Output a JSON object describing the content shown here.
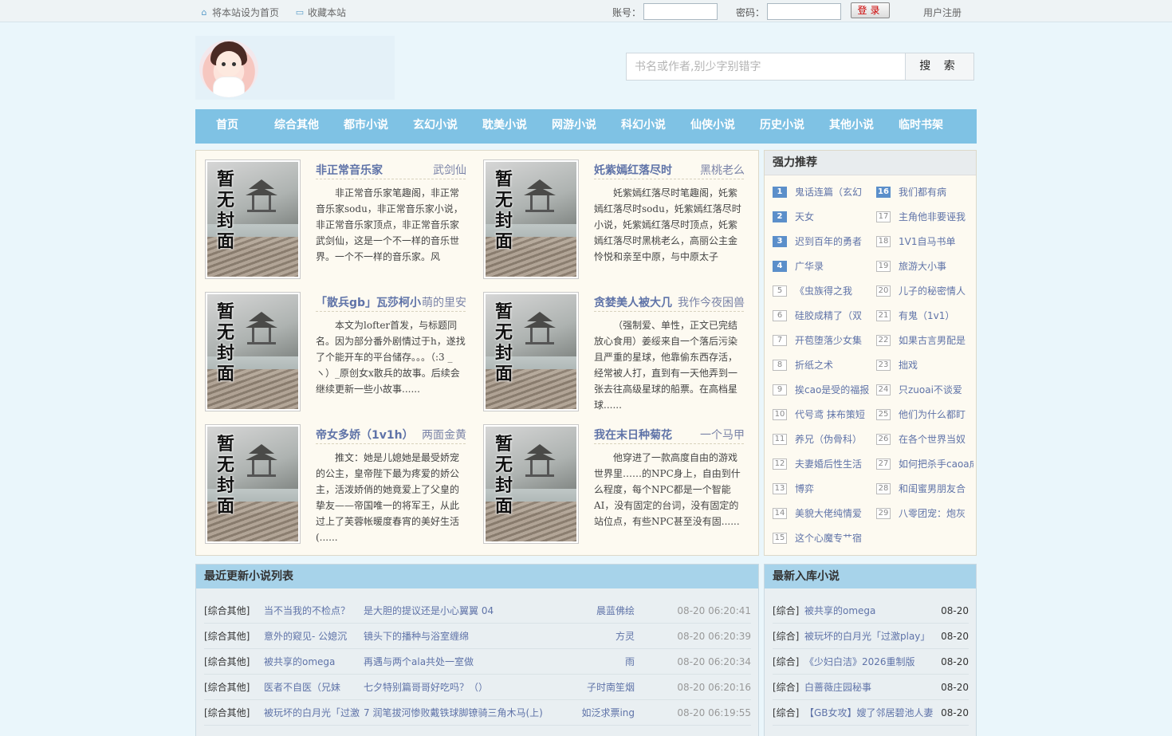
{
  "topbar": {
    "set_home": "将本站设为首页",
    "bookmark": "收藏本站",
    "account_label": "账号：",
    "password_label": "密码：",
    "account_value": "",
    "password_value": "",
    "login_button": "登录",
    "register": "用户注册"
  },
  "search": {
    "placeholder": "书名或作者,别少字别错字",
    "button": "搜 索"
  },
  "nav": [
    "首页",
    "综合其他",
    "都市小说",
    "玄幻小说",
    "耽美小说",
    "网游小说",
    "科幻小说",
    "仙侠小说",
    "历史小说",
    "其他小说",
    "临时书架"
  ],
  "cover_text": [
    "暂",
    "无",
    "封",
    "面"
  ],
  "featured": [
    {
      "title": "非正常音乐家",
      "author": "武剑仙",
      "desc": "非正常音乐家笔趣阁，非正常音乐家sodu，非正常音乐家小说，非正常音乐家顶点，非正常音乐家武剑仙，这是一个不一样的音乐世界。一个不一样的音乐家。风平......"
    },
    {
      "title": "奼紫嫣红落尽时",
      "author": "黑桃老么",
      "desc": "奼紫嫣红落尽时笔趣阁，奼紫嫣红落尽时sodu，奼紫嫣红落尽时小说，奼紫嫣红落尽时顶点，奼紫嫣红落尽时黑桃老么，高丽公主金怜悦和亲至中原，与中原太子李......"
    },
    {
      "title": "「散兵gb」瓦莎柯小",
      "author": "萌的里安",
      "desc": "本文为lofter首发，与标题同名。因为部分番外剧情过于h，遂找了个能开车的平台储存。。。（:3 _ ヽ）_原创女x散兵的故事。后续会继续更新一些小故事......"
    },
    {
      "title": "贪婪美人被大几",
      "author": "我作今夜困兽",
      "desc": "（强制爱、单性，正文已完结放心食用）姜绥来自一个落后污染且严重的星球，他靠偷东西存活，经常被人打，直到有一天他弄到一张去往高级星球的船票。在高档星球......"
    },
    {
      "title": "帝女多娇（1v1h）",
      "author": "两面金黄",
      "desc": "推文：她是儿媳她是最受娇宠的公主，皇帝陛下最为疼爱的娇公主，活泼娇俏的她竟爱上了父皇的挚友——帝国唯一的将军王，从此过上了芙蓉帐暖度春宵的美好生活(......"
    },
    {
      "title": "我在末日种菊花",
      "author": "一个马甲",
      "desc": "他穿进了一款高度自由的游戏世界里……的NPC身上，自由到什么程度，每个NPC都是一个智能AI，没有固定的台词，没有固定的站位点，有些NPC甚至没有固......"
    }
  ],
  "recommend": {
    "heading": "强力推荐",
    "items": [
      {
        "num": "1",
        "title": "鬼话连篇（玄幻"
      },
      {
        "num": "2",
        "title": "天女"
      },
      {
        "num": "3",
        "title": "迟到百年的勇者"
      },
      {
        "num": "4",
        "title": "广华录"
      },
      {
        "num": "5",
        "title": "《虫族得之我"
      },
      {
        "num": "6",
        "title": "硅胶成精了（双"
      },
      {
        "num": "7",
        "title": "开苞堕落少女集"
      },
      {
        "num": "8",
        "title": "折纸之术"
      },
      {
        "num": "9",
        "title": "挨cao是受的福报"
      },
      {
        "num": "10",
        "title": "代号鸢 抹布策短"
      },
      {
        "num": "11",
        "title": "养兄（伪骨科）"
      },
      {
        "num": "12",
        "title": "夫妻婚后性生活"
      },
      {
        "num": "13",
        "title": "博弈"
      },
      {
        "num": "14",
        "title": "美貌大佬纯情爱"
      },
      {
        "num": "15",
        "title": "这个心魔专艹宿"
      },
      {
        "num": "16",
        "title": "我们都有病"
      },
      {
        "num": "17",
        "title": "主角他非要诬我"
      },
      {
        "num": "18",
        "title": "1V1自马书单"
      },
      {
        "num": "19",
        "title": "旅游大小事"
      },
      {
        "num": "20",
        "title": "儿子的秘密情人"
      },
      {
        "num": "21",
        "title": "有鬼（1v1）"
      },
      {
        "num": "22",
        "title": "如果古言男配是"
      },
      {
        "num": "23",
        "title": "拙戏"
      },
      {
        "num": "24",
        "title": "只zuoai不谈爱"
      },
      {
        "num": "25",
        "title": "他们为什么都盯"
      },
      {
        "num": "26",
        "title": "在各个世界当奴"
      },
      {
        "num": "27",
        "title": "如何把杀手caoa成"
      },
      {
        "num": "28",
        "title": "和闺蜜男朋友合"
      },
      {
        "num": "29",
        "title": "八零团宠：炮灰"
      }
    ]
  },
  "recent": {
    "heading": "最近更新小说列表",
    "rows": [
      {
        "cat": "[综合其他]",
        "title": "当不当我的不检点？",
        "chapter": "是大胆的提议还是小心翼翼 04",
        "author": "晨蓝佛绘",
        "time": "08-20 06:20:41"
      },
      {
        "cat": "[综合其他]",
        "title": "意外的窥见- 公媳沉",
        "chapter": "镜头下的播种与浴室缠绵",
        "author": "方灵",
        "time": "08-20 06:20:39"
      },
      {
        "cat": "[综合其他]",
        "title": "被共享的omega",
        "chapter": "再遇与两个ala共处一室做",
        "author": "雨",
        "time": "08-20 06:20:34"
      },
      {
        "cat": "[综合其他]",
        "title": "医者不自医（兄妹",
        "chapter": "七夕特别篇哥哥好吃吗？（）",
        "author": "子时南笙烟",
        "time": "08-20 06:20:16"
      },
      {
        "cat": "[综合其他]",
        "title": "被玩坏的白月光「过激",
        "chapter": "7 润笔拔河惨败戴铁球脚镣骑三角木马(上)",
        "author": "如泛求票ing",
        "time": "08-20 06:19:55"
      }
    ]
  },
  "newest": {
    "heading": "最新入库小说",
    "rows": [
      {
        "cat": "[综合]",
        "title": "被共享的omega",
        "date": "08-20"
      },
      {
        "cat": "[综合]",
        "title": "被玩坏的白月光「过激play」",
        "date": "08-20"
      },
      {
        "cat": "[综合]",
        "title": "《少妇白洁》2026重制版",
        "date": "08-20"
      },
      {
        "cat": "[综合]",
        "title": "白蔷薇庄园秘事",
        "date": "08-20"
      },
      {
        "cat": "[综合]",
        "title": "【GB女攻】嫂了邻居碧池人妻",
        "date": "08-20"
      }
    ]
  }
}
